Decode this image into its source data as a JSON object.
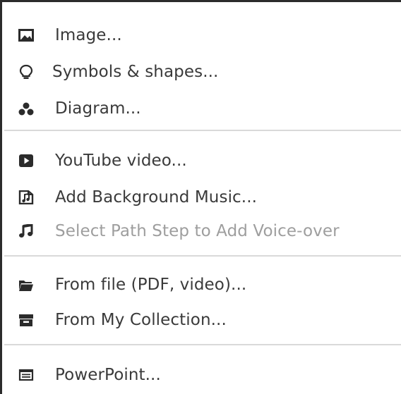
{
  "menu": {
    "groups": [
      {
        "items": [
          {
            "label": "Image...",
            "icon": "image-icon",
            "enabled": true
          },
          {
            "label": "Symbols & shapes...",
            "icon": "lightbulb-icon",
            "enabled": true
          },
          {
            "label": "Diagram...",
            "icon": "diagram-icon",
            "enabled": true
          }
        ]
      },
      {
        "items": [
          {
            "label": "YouTube video...",
            "icon": "youtube-play-icon",
            "enabled": true
          },
          {
            "label": "Add Background Music...",
            "icon": "music-file-icon",
            "enabled": true
          },
          {
            "label": "Select Path Step to Add Voice-over",
            "icon": "music-note-icon",
            "enabled": false
          }
        ]
      },
      {
        "items": [
          {
            "label": "From file (PDF, video)...",
            "icon": "folder-open-icon",
            "enabled": true
          },
          {
            "label": "From My Collection...",
            "icon": "collection-box-icon",
            "enabled": true
          }
        ]
      },
      {
        "items": [
          {
            "label": "PowerPoint...",
            "icon": "presentation-icon",
            "enabled": true
          }
        ]
      }
    ],
    "colors": {
      "text": "#3a3a3a",
      "disabled_text": "#9e9e9e",
      "icon": "#2b2b2b",
      "separator": "#d9d9d9",
      "border": "#2b2b2b"
    }
  }
}
